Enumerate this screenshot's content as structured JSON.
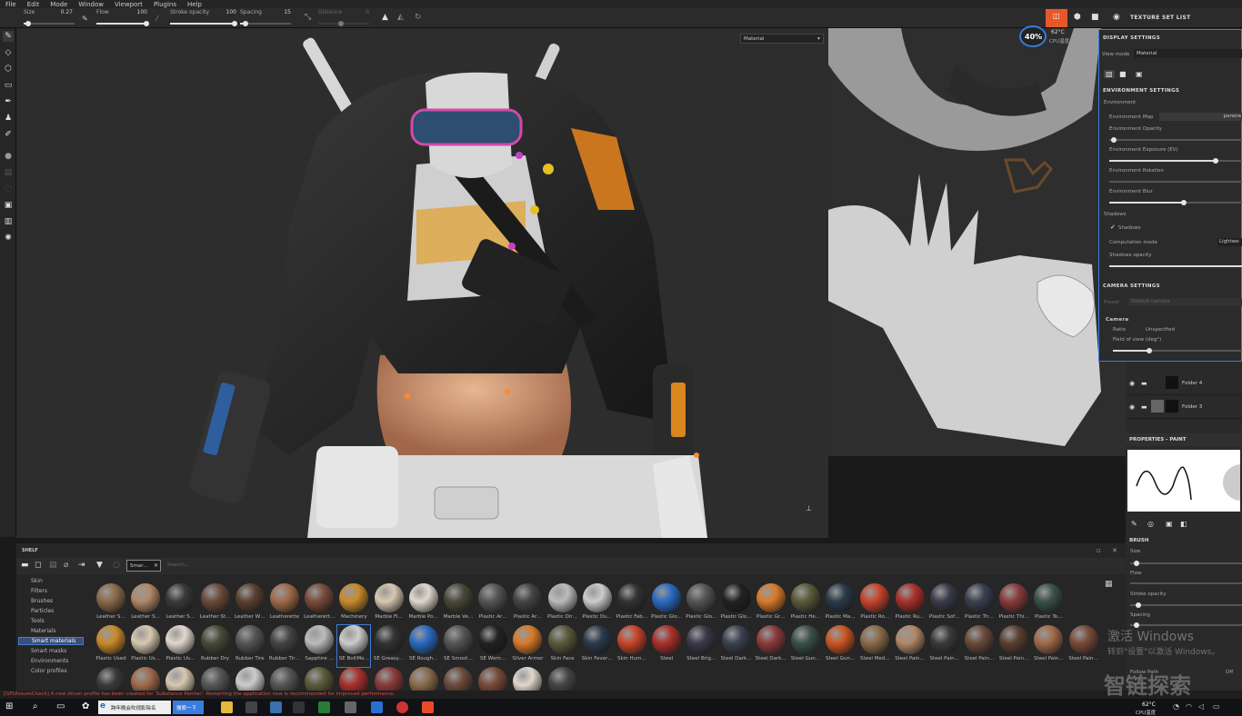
{
  "menu": [
    "File",
    "Edit",
    "Mode",
    "Window",
    "Viewport",
    "Plugins",
    "Help"
  ],
  "toolbar": {
    "size_label": "Size",
    "size_value": "0.27",
    "flow_label": "Flow",
    "flow_value": "100",
    "stroke_label": "Stroke opacity",
    "stroke_value": "100",
    "spacing_label": "Spacing",
    "spacing_value": "15",
    "distance_label": "Distance",
    "distance_value": "0"
  },
  "viewport": {
    "mode_select": "Material",
    "right_view_axis": "U"
  },
  "perf": {
    "percent": "40%",
    "temp": "62°C",
    "temp_label": "CPU温度"
  },
  "texture_set_list_title": "TEXTURE SET LIST",
  "display_settings": {
    "title": "DISPLAY SETTINGS",
    "view_mode_label": "View mode",
    "view_mode_value": "Material",
    "env_settings_title": "ENVIRONMENT SETTINGS",
    "environment_label": "Environment",
    "env_map_label": "Environment Map",
    "env_map_value": "panora",
    "env_opacity_label": "Environment Opacity",
    "env_exposure_label": "Environment Exposure (EV)",
    "env_rotation_label": "Environment Rotation",
    "env_blur_label": "Environment Blur",
    "shadows_section": "Shadows",
    "shadows_check": "Shadows",
    "computation_label": "Computation mode",
    "computation_value": "Lightwe",
    "shadows_opacity_label": "Shadows opacity",
    "camera_settings_title": "CAMERA SETTINGS",
    "preset_label": "Preset",
    "preset_value": "Default camera",
    "camera_label": "Camera",
    "ratio_label": "Ratio",
    "ratio_value": "Unspecified",
    "fov_label": "Field of view (deg°)"
  },
  "layers": [
    {
      "name": "Folder 4"
    },
    {
      "name": "Folder 3"
    }
  ],
  "properties": {
    "title": "PROPERTIES - PAINT",
    "brush_title": "BRUSH",
    "size_label": "Size",
    "flow_label": "Flow",
    "stroke_label": "Stroke opacity",
    "spacing_label": "Spacing",
    "follow_path_label": "Follow Path",
    "follow_path_value": "Off"
  },
  "shelf": {
    "title": "SHELF",
    "search_tag": "Smar…",
    "search_placeholder": "Search...",
    "categories": [
      "Skin",
      "Filters",
      "Brushes",
      "Particles",
      "Tools",
      "Materials",
      "Smart materials",
      "Smart masks",
      "Environments",
      "Color profiles"
    ],
    "selected_category": "Smart materials",
    "row1": [
      "",
      "",
      "",
      "",
      "",
      "",
      "",
      "",
      "",
      "",
      "",
      "",
      "",
      "",
      "",
      "",
      "",
      "",
      "",
      "",
      "",
      "",
      "",
      "",
      "",
      "",
      "",
      "",
      ""
    ],
    "row2": [
      "Leather S…",
      "Leather S…",
      "Leather S…",
      "Leather St…",
      "Leather W…",
      "Leatherette",
      "Leatherett…",
      "Machinery",
      "Marble Fi…",
      "Marble Po…",
      "Marble Ve…",
      "Plastic Ar…",
      "Plastic Ar…",
      "Plastic Dir…",
      "Plastic Du…",
      "Plastic Fab…",
      "Plastic Glo…",
      "Plastic Glo…",
      "Plastic Glo…",
      "Plastic Gr…",
      "Plastic He…",
      "Plastic Ma…",
      "Plastic Ro…",
      "Plastic Ru…",
      "Plastic Sof…",
      "Plastic Th…",
      "Plastic Thi…",
      "Plastic To…"
    ],
    "row3": [
      "Plastic Used",
      "Plastic Us…",
      "Plastic Us…",
      "Rubber Dry",
      "Rubber Tire",
      "Rubber Tir…",
      "Sapphire …",
      "SE BoltMe…",
      "SE Greasy…",
      "SE Rough…",
      "SE Smoot…",
      "SE Worn…",
      "Silver Armor",
      "Skin Face",
      "Skin Fever…",
      "Skin Hum…",
      "Steel",
      "Steel Brig…",
      "Steel Dark…",
      "Steel Dark…",
      "Steel Gun…",
      "Steel Gun…",
      "Steel Med…",
      "Steel Pain…",
      "Steel Pain…",
      "Steel Pain…",
      "Steel Pain…",
      "Steel Pain…",
      "Steel Pain…"
    ]
  },
  "status_message": "[GPUIssuesCheck] A new driver profile has been created for 'Substance Painter'. Restarting the application now is recommended for improved performance.",
  "watermark": {
    "activate_line1": "激活 Windows",
    "activate_line2": "转到\"设置\"以激活 Windows。",
    "brand": "智链探索"
  },
  "taskbar": {
    "browser_tab": "跨年晚会吹视影除名",
    "search_btn": "搜索一下",
    "temp": "62°C",
    "temp_label": "CPU温度"
  },
  "colors": {
    "accent": "#3b7bd6",
    "selected": "#37507a",
    "status_red": "#d05050",
    "perf_orange": "#e8572a"
  }
}
